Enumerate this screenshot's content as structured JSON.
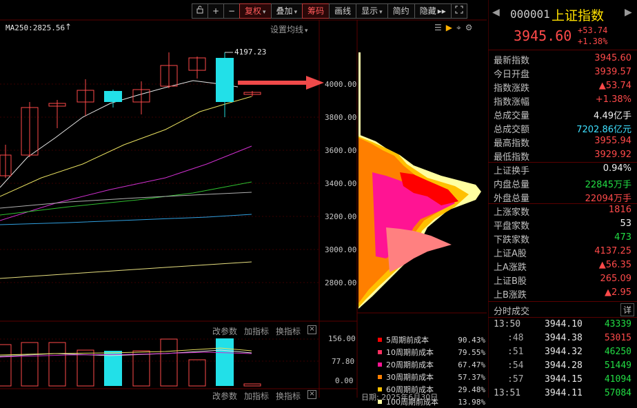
{
  "toolbar": {
    "lock_icon": "lock-icon",
    "plus": "+",
    "minus": "−",
    "restore_label": "复权",
    "overlay_label": "叠加",
    "chips_label": "筹码",
    "draw_label": "画线",
    "display_label": "显示",
    "simple_label": "简约",
    "hide_label": "隐藏",
    "more_icon": "double-chevron-right-icon",
    "fullscreen_icon": "expand-icon"
  },
  "ma_label": "MA250:2825.56",
  "set_ma_label": "设置均线",
  "high_marker": "4197.23",
  "price_axis": [
    "4000.00",
    "3800.00",
    "3600.00",
    "3400.00",
    "3200.00",
    "3000.00",
    "2800.00"
  ],
  "volume_axis": [
    "156.00",
    "77.80",
    "0.00"
  ],
  "volume_controls": {
    "params": "改参数",
    "add": "加指标",
    "swap": "换指标"
  },
  "chip_legend": [
    {
      "name": "5周期前成本",
      "pct": "90.43%",
      "color": "#ff0000"
    },
    {
      "name": "10周期前成本",
      "pct": "79.55%",
      "color": "#ff3060"
    },
    {
      "name": "20周期前成本",
      "pct": "67.47%",
      "color": "#ff1493"
    },
    {
      "name": "30周期前成本",
      "pct": "57.37%",
      "color": "#ff7f00"
    },
    {
      "name": "60周期前成本",
      "pct": "29.48%",
      "color": "#ffc000"
    },
    {
      "name": "100周期前成本",
      "pct": "13.98%",
      "color": "#ffffa0"
    }
  ],
  "date_partial": "日期: 2025年6月30日",
  "index": {
    "code": "000001",
    "name": "上证指数",
    "price": "3945.60",
    "change": "+53.74",
    "change_pct": "+1.38%"
  },
  "quote_rows": [
    {
      "k": "最新指数",
      "v": "3945.60",
      "c": "red"
    },
    {
      "k": "今日开盘",
      "v": "3939.57",
      "c": "red"
    },
    {
      "k": "指数涨跌",
      "v": "▲53.74",
      "c": "red"
    },
    {
      "k": "指数涨幅",
      "v": "+1.38%",
      "c": "red"
    },
    {
      "k": "总成交量",
      "v": "4.49亿手",
      "c": "white"
    },
    {
      "k": "总成交额",
      "v": "7202.86亿元",
      "c": "cyan"
    },
    {
      "k": "最高指数",
      "v": "3955.94",
      "c": "red"
    },
    {
      "k": "最低指数",
      "v": "3929.92",
      "c": "red"
    }
  ],
  "quote_rows2": [
    {
      "k": "上证换手",
      "v": "0.94%",
      "c": "white"
    },
    {
      "k": "内盘总量",
      "v": "22845万手",
      "c": "green"
    },
    {
      "k": "外盘总量",
      "v": "22094万手",
      "c": "red"
    }
  ],
  "quote_rows3": [
    {
      "k": "上涨家数",
      "v": "1816",
      "c": "red"
    },
    {
      "k": "平盘家数",
      "v": "53",
      "c": "white"
    },
    {
      "k": "下跌家数",
      "v": "473",
      "c": "green"
    },
    {
      "k": "上证A股",
      "v": "4137.25",
      "c": "red"
    },
    {
      "k": "上A涨跌",
      "v": "▲56.35",
      "c": "red"
    },
    {
      "k": "上证B股",
      "v": "265.09",
      "c": "red"
    },
    {
      "k": "上B涨跌",
      "v": "▲2.95",
      "c": "red"
    }
  ],
  "ticks_header": {
    "title": "分时成交",
    "detail": "详"
  },
  "ticks": [
    {
      "t": "13:50",
      "p": "3944.10",
      "v": "43339"
    },
    {
      "t": ":48",
      "p": "3944.38",
      "v": "53015"
    },
    {
      "t": ":51",
      "p": "3944.32",
      "v": "46250"
    },
    {
      "t": ":54",
      "p": "3944.28",
      "v": "51449"
    },
    {
      "t": ":57",
      "p": "3944.15",
      "v": "41094"
    },
    {
      "t": "13:51",
      "p": "3944.11",
      "v": "57084"
    }
  ],
  "colors": {
    "up": "#ff4a4a",
    "down": "#22dd44",
    "accent": "#3ee0ff",
    "chart_bg": "#000000"
  }
}
